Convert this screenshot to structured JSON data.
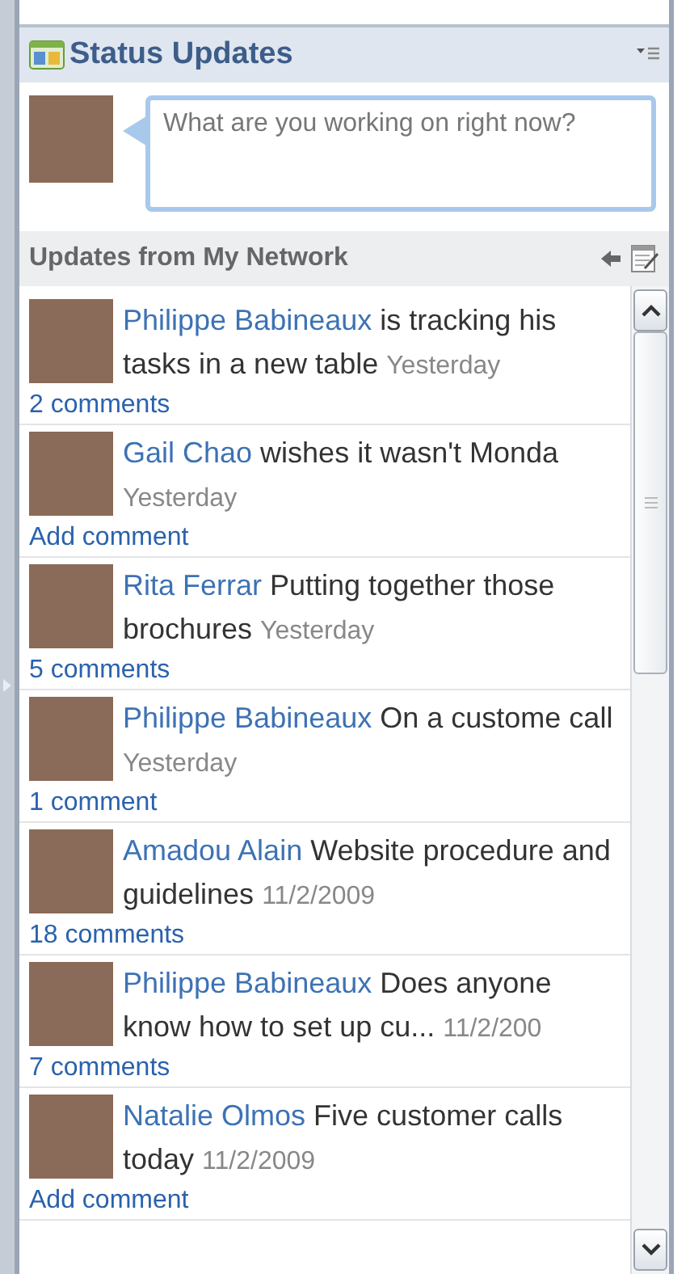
{
  "panel": {
    "title": "Status Updates"
  },
  "status_input": {
    "placeholder": "What are you working on right now?"
  },
  "network": {
    "title": "Updates from My Network",
    "updates": [
      {
        "author": "Philippe Babineaux",
        "message": "is tracking his tasks in a new table",
        "time": "Yesterday",
        "comments": "2 comments"
      },
      {
        "author": "Gail Chao",
        "message": "wishes it wasn't Monda",
        "time": "Yesterday",
        "comments": "Add comment"
      },
      {
        "author": "Rita Ferrar",
        "message": "Putting together those brochures",
        "time": "Yesterday",
        "comments": "5 comments"
      },
      {
        "author": "Philippe Babineaux",
        "message": "On a custome call",
        "time": "Yesterday",
        "comments": "1 comment"
      },
      {
        "author": "Amadou Alain",
        "message": "Website procedure and guidelines",
        "time": "11/2/2009",
        "comments": "18 comments"
      },
      {
        "author": "Philippe Babineaux",
        "message": "Does anyone know how to set up cu...",
        "time": "11/2/200",
        "comments": "7 comments"
      },
      {
        "author": "Natalie Olmos",
        "message": "Five customer calls today",
        "time": "11/2/2009",
        "comments": "Add comment"
      }
    ]
  }
}
